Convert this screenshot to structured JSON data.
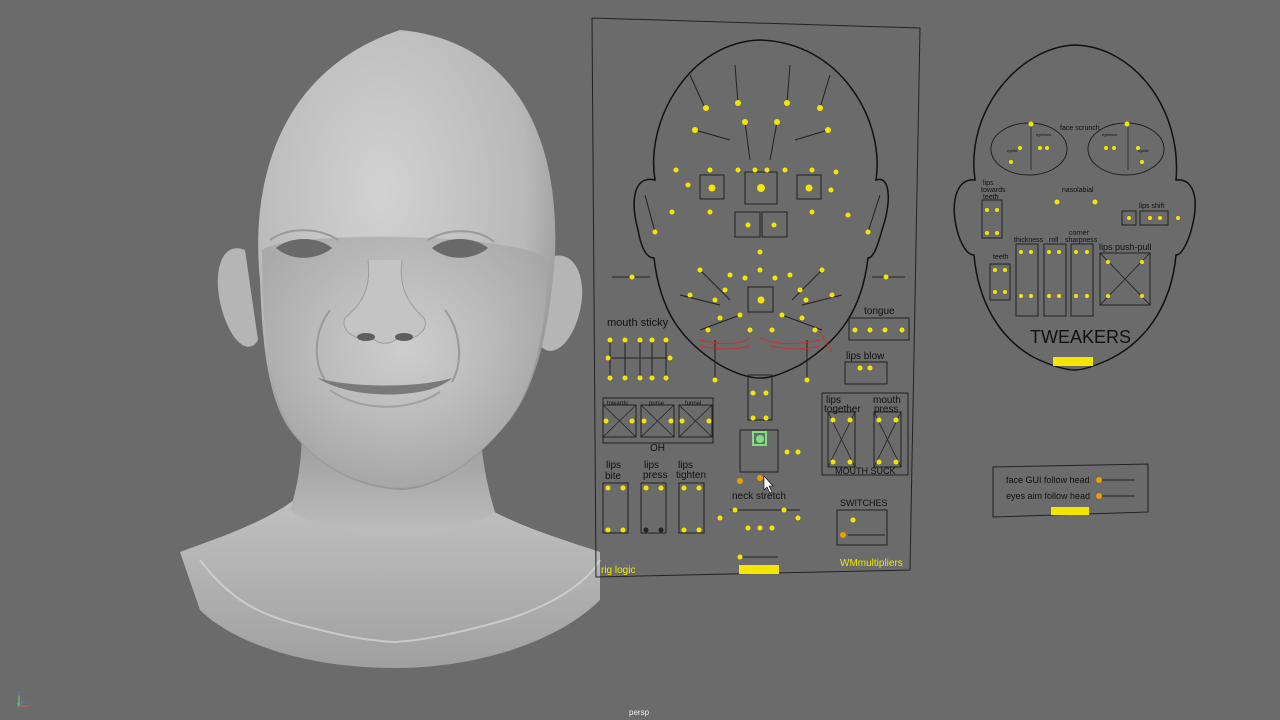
{
  "viewport": {
    "camera": "persp",
    "background": "#6b6b6b",
    "axis_labels": [
      "z",
      "y",
      "x"
    ]
  },
  "rig_panel": {
    "sections": {
      "mouth_sticky": "mouth sticky",
      "tongue": "tongue",
      "lips_blow": "lips blow",
      "oh_towards": "towards",
      "oh_purse": "purse",
      "oh_funnel": "funnel",
      "oh": "OH",
      "lips_together_1": "lips",
      "lips_together_2": "together",
      "mouth_press_1": "mouth",
      "mouth_press_2": "press",
      "mouth_suck": "MOUTH SUCK",
      "lips_bite_1": "lips",
      "lips_bite_2": "bite",
      "lips_press_1": "lips",
      "lips_press_2": "press",
      "lips_tighten_1": "lips",
      "lips_tighten_2": "tighten",
      "neck_stretch": "neck stretch",
      "switches": "SWITCHES"
    },
    "footer_left": "rig logic",
    "footer_right": "WMmultipliers"
  },
  "tweakers_panel": {
    "title": "TWEAKERS",
    "labels": {
      "face_scrunch": "face scrunch",
      "nasolabial": "nasolabial",
      "lips_towards_teeth_1": "lips",
      "lips_towards_teeth_2": "towards",
      "lips_towards_teeth_3": "teeth",
      "lips_shift": "lips shift",
      "thickness": "thickness",
      "roll": "roll",
      "corner_sharpness_1": "corner",
      "corner_sharpness_2": "sharpness",
      "teeth": "teeth",
      "lips_push_pull": "lips push-pull",
      "eyebrow_l": "eyebrow",
      "eyebrow_r": "eyebrow",
      "eyelid_l": "eyelid",
      "eyelid_r": "eyelid"
    }
  },
  "follow_panel": {
    "face_gui_follow_head": "face GUI follow head",
    "eyes_aim_follow_head": "eyes aim follow head"
  },
  "colors": {
    "control_yellow": "#f4e600",
    "control_orange": "#e8a200",
    "outline": "#111111",
    "selected_green": "#7fe07f",
    "red_guides": "#c83030"
  }
}
